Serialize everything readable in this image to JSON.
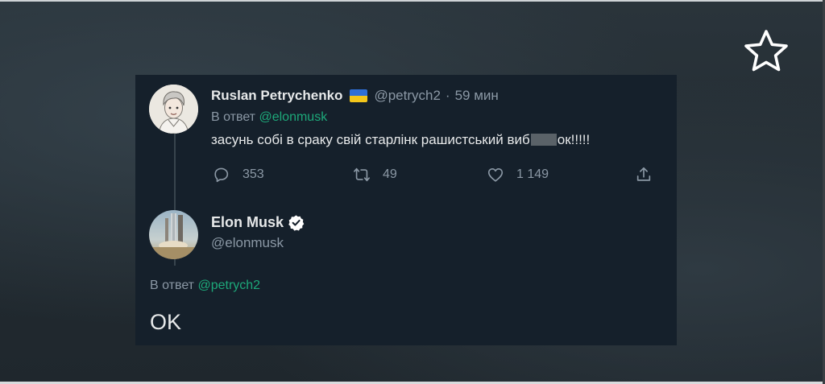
{
  "reply_tweet": {
    "author_name": "Ruslan Petrychenko",
    "handle": "@petrych2",
    "separator": "·",
    "time": "59 мин",
    "replying_prefix": "В ответ",
    "replying_to": "@elonmusk",
    "text_before": "засунь собі в сраку свій старлінк рашистський виб",
    "text_after": "ок!!!!!",
    "actions": {
      "reply_count": "353",
      "retweet_count": "49",
      "like_count": "1 149"
    }
  },
  "main_tweet": {
    "author_name": "Elon Musk",
    "handle": "@elonmusk",
    "replying_prefix": "В ответ",
    "replying_to": "@petrych2",
    "text": "OK",
    "verified": true
  },
  "colors": {
    "card_background": "#15202b",
    "text_primary": "#e7e9ea",
    "text_secondary": "#8b98a5",
    "mention": "#1da97a",
    "verified_badge": "#ffffff"
  },
  "icons": [
    "star-icon",
    "reply-icon",
    "retweet-icon",
    "like-icon",
    "share-icon",
    "verified-icon",
    "ukraine-flag-icon"
  ]
}
